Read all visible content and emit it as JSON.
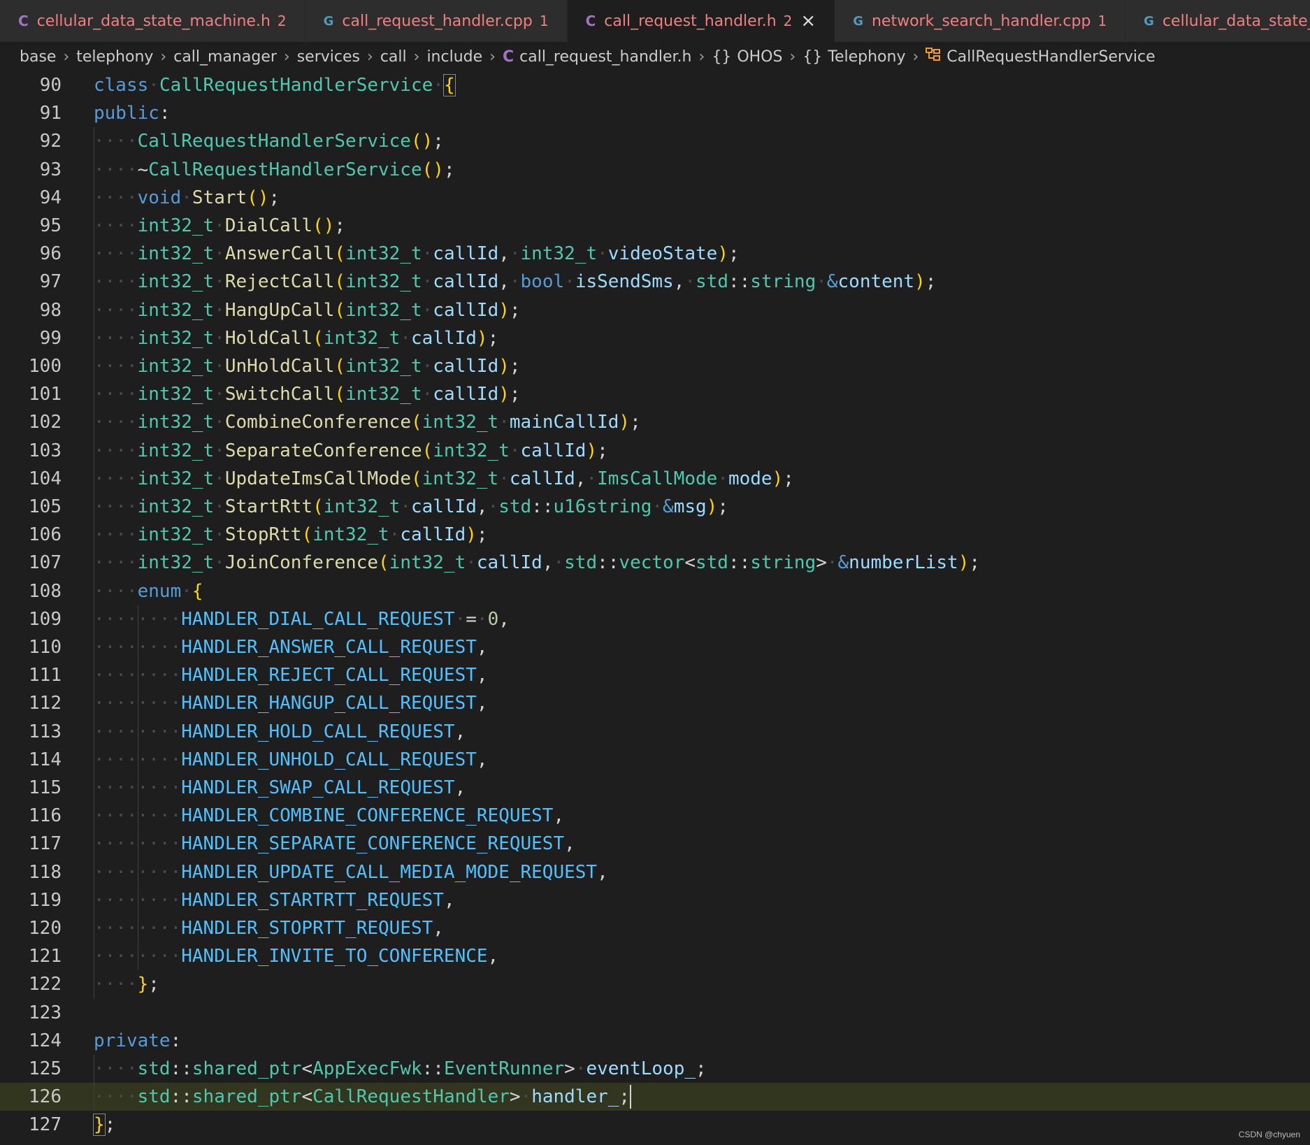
{
  "tabs": [
    {
      "icon": "C",
      "name": "cellular_data_state_machine.h",
      "count": "2",
      "active": false
    },
    {
      "icon": "G",
      "name": "call_request_handler.cpp",
      "count": "1",
      "active": false
    },
    {
      "icon": "C",
      "name": "call_request_handler.h",
      "count": "2",
      "active": true
    },
    {
      "icon": "G",
      "name": "network_search_handler.cpp",
      "count": "1",
      "active": false
    },
    {
      "icon": "G",
      "name": "cellular_data_state_machine",
      "count": "",
      "active": false
    }
  ],
  "breadcrumb": {
    "items": [
      "base",
      "telephony",
      "call_manager",
      "services",
      "call",
      "include"
    ],
    "file_icon": "C",
    "file": "call_request_handler.h",
    "ns_icon": "{}",
    "namespace1": "OHOS",
    "namespace2": "Telephony",
    "class_name": "CallRequestHandlerService"
  },
  "editor": {
    "lines": [
      {
        "n": "90",
        "indent": 0,
        "tokens": [
          [
            "kw",
            "class"
          ],
          [
            "ws",
            "·"
          ],
          [
            "ty",
            "CallRequestHandlerService"
          ],
          [
            "ws",
            "·"
          ],
          [
            "brhl",
            "{"
          ]
        ]
      },
      {
        "n": "91",
        "indent": 0,
        "tokens": [
          [
            "kw",
            "public"
          ],
          [
            "pu",
            ":"
          ]
        ]
      },
      {
        "n": "92",
        "indent": 1,
        "tokens": [
          [
            "ty",
            "CallRequestHandlerService"
          ],
          [
            "br",
            "()"
          ],
          [
            "pu",
            ";"
          ]
        ]
      },
      {
        "n": "93",
        "indent": 1,
        "tokens": [
          [
            "pu",
            "~"
          ],
          [
            "ty",
            "CallRequestHandlerService"
          ],
          [
            "br",
            "()"
          ],
          [
            "pu",
            ";"
          ]
        ]
      },
      {
        "n": "94",
        "indent": 1,
        "tokens": [
          [
            "kw",
            "void"
          ],
          [
            "ws",
            "·"
          ],
          [
            "fn",
            "Start"
          ],
          [
            "br",
            "()"
          ],
          [
            "pu",
            ";"
          ]
        ]
      },
      {
        "n": "95",
        "indent": 1,
        "tokens": [
          [
            "ty",
            "int32_t"
          ],
          [
            "ws",
            "·"
          ],
          [
            "fn",
            "DialCall"
          ],
          [
            "br",
            "()"
          ],
          [
            "pu",
            ";"
          ]
        ]
      },
      {
        "n": "96",
        "indent": 1,
        "tokens": [
          [
            "ty",
            "int32_t"
          ],
          [
            "ws",
            "·"
          ],
          [
            "fn",
            "AnswerCall"
          ],
          [
            "br",
            "("
          ],
          [
            "ty",
            "int32_t"
          ],
          [
            "ws",
            "·"
          ],
          [
            "var",
            "callId"
          ],
          [
            "pu",
            ","
          ],
          [
            "ws",
            "·"
          ],
          [
            "ty",
            "int32_t"
          ],
          [
            "ws",
            "·"
          ],
          [
            "var",
            "videoState"
          ],
          [
            "br",
            ")"
          ],
          [
            "pu",
            ";"
          ]
        ]
      },
      {
        "n": "97",
        "indent": 1,
        "tokens": [
          [
            "ty",
            "int32_t"
          ],
          [
            "ws",
            "·"
          ],
          [
            "fn",
            "RejectCall"
          ],
          [
            "br",
            "("
          ],
          [
            "ty",
            "int32_t"
          ],
          [
            "ws",
            "·"
          ],
          [
            "var",
            "callId"
          ],
          [
            "pu",
            ","
          ],
          [
            "ws",
            "·"
          ],
          [
            "kw",
            "bool"
          ],
          [
            "ws",
            "·"
          ],
          [
            "var",
            "isSendSms"
          ],
          [
            "pu",
            ","
          ],
          [
            "ws",
            "·"
          ],
          [
            "ty",
            "std"
          ],
          [
            "pu",
            "::"
          ],
          [
            "ty",
            "string"
          ],
          [
            "ws",
            "·"
          ],
          [
            "kw",
            "&"
          ],
          [
            "var",
            "content"
          ],
          [
            "br",
            ")"
          ],
          [
            "pu",
            ";"
          ]
        ]
      },
      {
        "n": "98",
        "indent": 1,
        "tokens": [
          [
            "ty",
            "int32_t"
          ],
          [
            "ws",
            "·"
          ],
          [
            "fn",
            "HangUpCall"
          ],
          [
            "br",
            "("
          ],
          [
            "ty",
            "int32_t"
          ],
          [
            "ws",
            "·"
          ],
          [
            "var",
            "callId"
          ],
          [
            "br",
            ")"
          ],
          [
            "pu",
            ";"
          ]
        ]
      },
      {
        "n": "99",
        "indent": 1,
        "tokens": [
          [
            "ty",
            "int32_t"
          ],
          [
            "ws",
            "·"
          ],
          [
            "fn",
            "HoldCall"
          ],
          [
            "br",
            "("
          ],
          [
            "ty",
            "int32_t"
          ],
          [
            "ws",
            "·"
          ],
          [
            "var",
            "callId"
          ],
          [
            "br",
            ")"
          ],
          [
            "pu",
            ";"
          ]
        ]
      },
      {
        "n": "100",
        "indent": 1,
        "tokens": [
          [
            "ty",
            "int32_t"
          ],
          [
            "ws",
            "·"
          ],
          [
            "fn",
            "UnHoldCall"
          ],
          [
            "br",
            "("
          ],
          [
            "ty",
            "int32_t"
          ],
          [
            "ws",
            "·"
          ],
          [
            "var",
            "callId"
          ],
          [
            "br",
            ")"
          ],
          [
            "pu",
            ";"
          ]
        ]
      },
      {
        "n": "101",
        "indent": 1,
        "tokens": [
          [
            "ty",
            "int32_t"
          ],
          [
            "ws",
            "·"
          ],
          [
            "fn",
            "SwitchCall"
          ],
          [
            "br",
            "("
          ],
          [
            "ty",
            "int32_t"
          ],
          [
            "ws",
            "·"
          ],
          [
            "var",
            "callId"
          ],
          [
            "br",
            ")"
          ],
          [
            "pu",
            ";"
          ]
        ]
      },
      {
        "n": "102",
        "indent": 1,
        "tokens": [
          [
            "ty",
            "int32_t"
          ],
          [
            "ws",
            "·"
          ],
          [
            "fn",
            "CombineConference"
          ],
          [
            "br",
            "("
          ],
          [
            "ty",
            "int32_t"
          ],
          [
            "ws",
            "·"
          ],
          [
            "var",
            "mainCallId"
          ],
          [
            "br",
            ")"
          ],
          [
            "pu",
            ";"
          ]
        ]
      },
      {
        "n": "103",
        "indent": 1,
        "tokens": [
          [
            "ty",
            "int32_t"
          ],
          [
            "ws",
            "·"
          ],
          [
            "fn",
            "SeparateConference"
          ],
          [
            "br",
            "("
          ],
          [
            "ty",
            "int32_t"
          ],
          [
            "ws",
            "·"
          ],
          [
            "var",
            "callId"
          ],
          [
            "br",
            ")"
          ],
          [
            "pu",
            ";"
          ]
        ]
      },
      {
        "n": "104",
        "indent": 1,
        "tokens": [
          [
            "ty",
            "int32_t"
          ],
          [
            "ws",
            "·"
          ],
          [
            "fn",
            "UpdateImsCallMode"
          ],
          [
            "br",
            "("
          ],
          [
            "ty",
            "int32_t"
          ],
          [
            "ws",
            "·"
          ],
          [
            "var",
            "callId"
          ],
          [
            "pu",
            ","
          ],
          [
            "ws",
            "·"
          ],
          [
            "ty",
            "ImsCallMode"
          ],
          [
            "ws",
            "·"
          ],
          [
            "var",
            "mode"
          ],
          [
            "br",
            ")"
          ],
          [
            "pu",
            ";"
          ]
        ]
      },
      {
        "n": "105",
        "indent": 1,
        "tokens": [
          [
            "ty",
            "int32_t"
          ],
          [
            "ws",
            "·"
          ],
          [
            "fn",
            "StartRtt"
          ],
          [
            "br",
            "("
          ],
          [
            "ty",
            "int32_t"
          ],
          [
            "ws",
            "·"
          ],
          [
            "var",
            "callId"
          ],
          [
            "pu",
            ","
          ],
          [
            "ws",
            "·"
          ],
          [
            "ty",
            "std"
          ],
          [
            "pu",
            "::"
          ],
          [
            "ty",
            "u16string"
          ],
          [
            "ws",
            "·"
          ],
          [
            "kw",
            "&"
          ],
          [
            "var",
            "msg"
          ],
          [
            "br",
            ")"
          ],
          [
            "pu",
            ";"
          ]
        ]
      },
      {
        "n": "106",
        "indent": 1,
        "tokens": [
          [
            "ty",
            "int32_t"
          ],
          [
            "ws",
            "·"
          ],
          [
            "fn",
            "StopRtt"
          ],
          [
            "br",
            "("
          ],
          [
            "ty",
            "int32_t"
          ],
          [
            "ws",
            "·"
          ],
          [
            "var",
            "callId"
          ],
          [
            "br",
            ")"
          ],
          [
            "pu",
            ";"
          ]
        ]
      },
      {
        "n": "107",
        "indent": 1,
        "tokens": [
          [
            "ty",
            "int32_t"
          ],
          [
            "ws",
            "·"
          ],
          [
            "fn",
            "JoinConference"
          ],
          [
            "br",
            "("
          ],
          [
            "ty",
            "int32_t"
          ],
          [
            "ws",
            "·"
          ],
          [
            "var",
            "callId"
          ],
          [
            "pu",
            ","
          ],
          [
            "ws",
            "·"
          ],
          [
            "ty",
            "std"
          ],
          [
            "pu",
            "::"
          ],
          [
            "ty",
            "vector"
          ],
          [
            "pu",
            "<"
          ],
          [
            "ty",
            "std"
          ],
          [
            "pu",
            "::"
          ],
          [
            "ty",
            "string"
          ],
          [
            "pu",
            ">"
          ],
          [
            "ws",
            "·"
          ],
          [
            "kw",
            "&"
          ],
          [
            "var",
            "numberList"
          ],
          [
            "br",
            ")"
          ],
          [
            "pu",
            ";"
          ]
        ]
      },
      {
        "n": "108",
        "indent": 1,
        "tokens": [
          [
            "kw",
            "enum"
          ],
          [
            "ws",
            "·"
          ],
          [
            "br",
            "{"
          ]
        ]
      },
      {
        "n": "109",
        "indent": 2,
        "tokens": [
          [
            "en",
            "HANDLER_DIAL_CALL_REQUEST"
          ],
          [
            "ws",
            "·"
          ],
          [
            "op",
            "="
          ],
          [
            "ws",
            "·"
          ],
          [
            "num",
            "0"
          ],
          [
            "pu",
            ","
          ]
        ]
      },
      {
        "n": "110",
        "indent": 2,
        "tokens": [
          [
            "en",
            "HANDLER_ANSWER_CALL_REQUEST"
          ],
          [
            "pu",
            ","
          ]
        ]
      },
      {
        "n": "111",
        "indent": 2,
        "tokens": [
          [
            "en",
            "HANDLER_REJECT_CALL_REQUEST"
          ],
          [
            "pu",
            ","
          ]
        ]
      },
      {
        "n": "112",
        "indent": 2,
        "tokens": [
          [
            "en",
            "HANDLER_HANGUP_CALL_REQUEST"
          ],
          [
            "pu",
            ","
          ]
        ]
      },
      {
        "n": "113",
        "indent": 2,
        "tokens": [
          [
            "en",
            "HANDLER_HOLD_CALL_REQUEST"
          ],
          [
            "pu",
            ","
          ]
        ]
      },
      {
        "n": "114",
        "indent": 2,
        "tokens": [
          [
            "en",
            "HANDLER_UNHOLD_CALL_REQUEST"
          ],
          [
            "pu",
            ","
          ]
        ]
      },
      {
        "n": "115",
        "indent": 2,
        "tokens": [
          [
            "en",
            "HANDLER_SWAP_CALL_REQUEST"
          ],
          [
            "pu",
            ","
          ]
        ]
      },
      {
        "n": "116",
        "indent": 2,
        "tokens": [
          [
            "en",
            "HANDLER_COMBINE_CONFERENCE_REQUEST"
          ],
          [
            "pu",
            ","
          ]
        ]
      },
      {
        "n": "117",
        "indent": 2,
        "tokens": [
          [
            "en",
            "HANDLER_SEPARATE_CONFERENCE_REQUEST"
          ],
          [
            "pu",
            ","
          ]
        ]
      },
      {
        "n": "118",
        "indent": 2,
        "tokens": [
          [
            "en",
            "HANDLER_UPDATE_CALL_MEDIA_MODE_REQUEST"
          ],
          [
            "pu",
            ","
          ]
        ]
      },
      {
        "n": "119",
        "indent": 2,
        "tokens": [
          [
            "en",
            "HANDLER_STARTRTT_REQUEST"
          ],
          [
            "pu",
            ","
          ]
        ]
      },
      {
        "n": "120",
        "indent": 2,
        "tokens": [
          [
            "en",
            "HANDLER_STOPRTT_REQUEST"
          ],
          [
            "pu",
            ","
          ]
        ]
      },
      {
        "n": "121",
        "indent": 2,
        "tokens": [
          [
            "en",
            "HANDLER_INVITE_TO_CONFERENCE"
          ],
          [
            "pu",
            ","
          ]
        ]
      },
      {
        "n": "122",
        "indent": 1,
        "tokens": [
          [
            "br",
            "}"
          ],
          [
            "pu",
            ";"
          ]
        ]
      },
      {
        "n": "123",
        "indent": 0,
        "tokens": []
      },
      {
        "n": "124",
        "indent": 0,
        "tokens": [
          [
            "kw",
            "private"
          ],
          [
            "pu",
            ":"
          ]
        ]
      },
      {
        "n": "125",
        "indent": 1,
        "tokens": [
          [
            "ty",
            "std"
          ],
          [
            "pu",
            "::"
          ],
          [
            "ty",
            "shared_ptr"
          ],
          [
            "pu",
            "<"
          ],
          [
            "ty",
            "AppExecFwk"
          ],
          [
            "pu",
            "::"
          ],
          [
            "ty",
            "EventRunner"
          ],
          [
            "pu",
            ">"
          ],
          [
            "ws",
            "·"
          ],
          [
            "var",
            "eventLoop_"
          ],
          [
            "pu",
            ";"
          ]
        ]
      },
      {
        "n": "126",
        "indent": 1,
        "current": true,
        "tokens": [
          [
            "ty",
            "std"
          ],
          [
            "pu",
            "::"
          ],
          [
            "ty",
            "shared_ptr"
          ],
          [
            "pu",
            "<"
          ],
          [
            "ty",
            "CallRequestHandler"
          ],
          [
            "pu",
            ">"
          ],
          [
            "ws",
            "·"
          ],
          [
            "var",
            "handler_"
          ],
          [
            "pu",
            ";"
          ]
        ]
      },
      {
        "n": "127",
        "indent": 0,
        "tokens": [
          [
            "brhl",
            "}"
          ],
          [
            "pu",
            ";"
          ]
        ]
      }
    ]
  },
  "watermark": "CSDN @chyuen",
  "colors": {
    "background": "#1e1e1e",
    "tab_inactive": "#2d2d2d",
    "error_text": "#f08080",
    "current_line": "#33361f"
  }
}
